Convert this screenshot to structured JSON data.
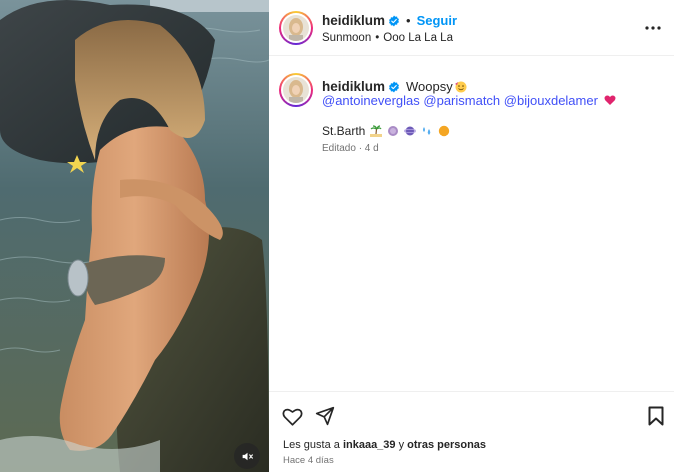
{
  "post": {
    "username": "heidiklum",
    "separator": "•",
    "follow_label": "Seguir",
    "audio": {
      "track": "Sunmoon",
      "separator": "•",
      "artist": "Ooo La La La"
    }
  },
  "caption": {
    "username": "heidiklum",
    "text": "Woopsy",
    "mentions": [
      "@antoineverglas",
      "@parismatch",
      "@bijouxdelamer"
    ],
    "location_line": "St.Barth",
    "edited": "Editado · 4 d"
  },
  "footer": {
    "likes_prefix": "Les gusta a ",
    "likes_user": "inkaaa_39",
    "likes_middle": " y ",
    "likes_others": "otras personas",
    "timestamp": "Hace 4 días"
  },
  "icons": {
    "verified": "verified-badge-icon",
    "more": "more-options-icon",
    "like": "heart-icon",
    "share": "paper-plane-icon",
    "save": "bookmark-icon",
    "mute": "speaker-muted-icon"
  },
  "colors": {
    "accent": "#0095f6",
    "mention": "#4150f7",
    "muted_text": "#737373",
    "border": "#efefef"
  }
}
